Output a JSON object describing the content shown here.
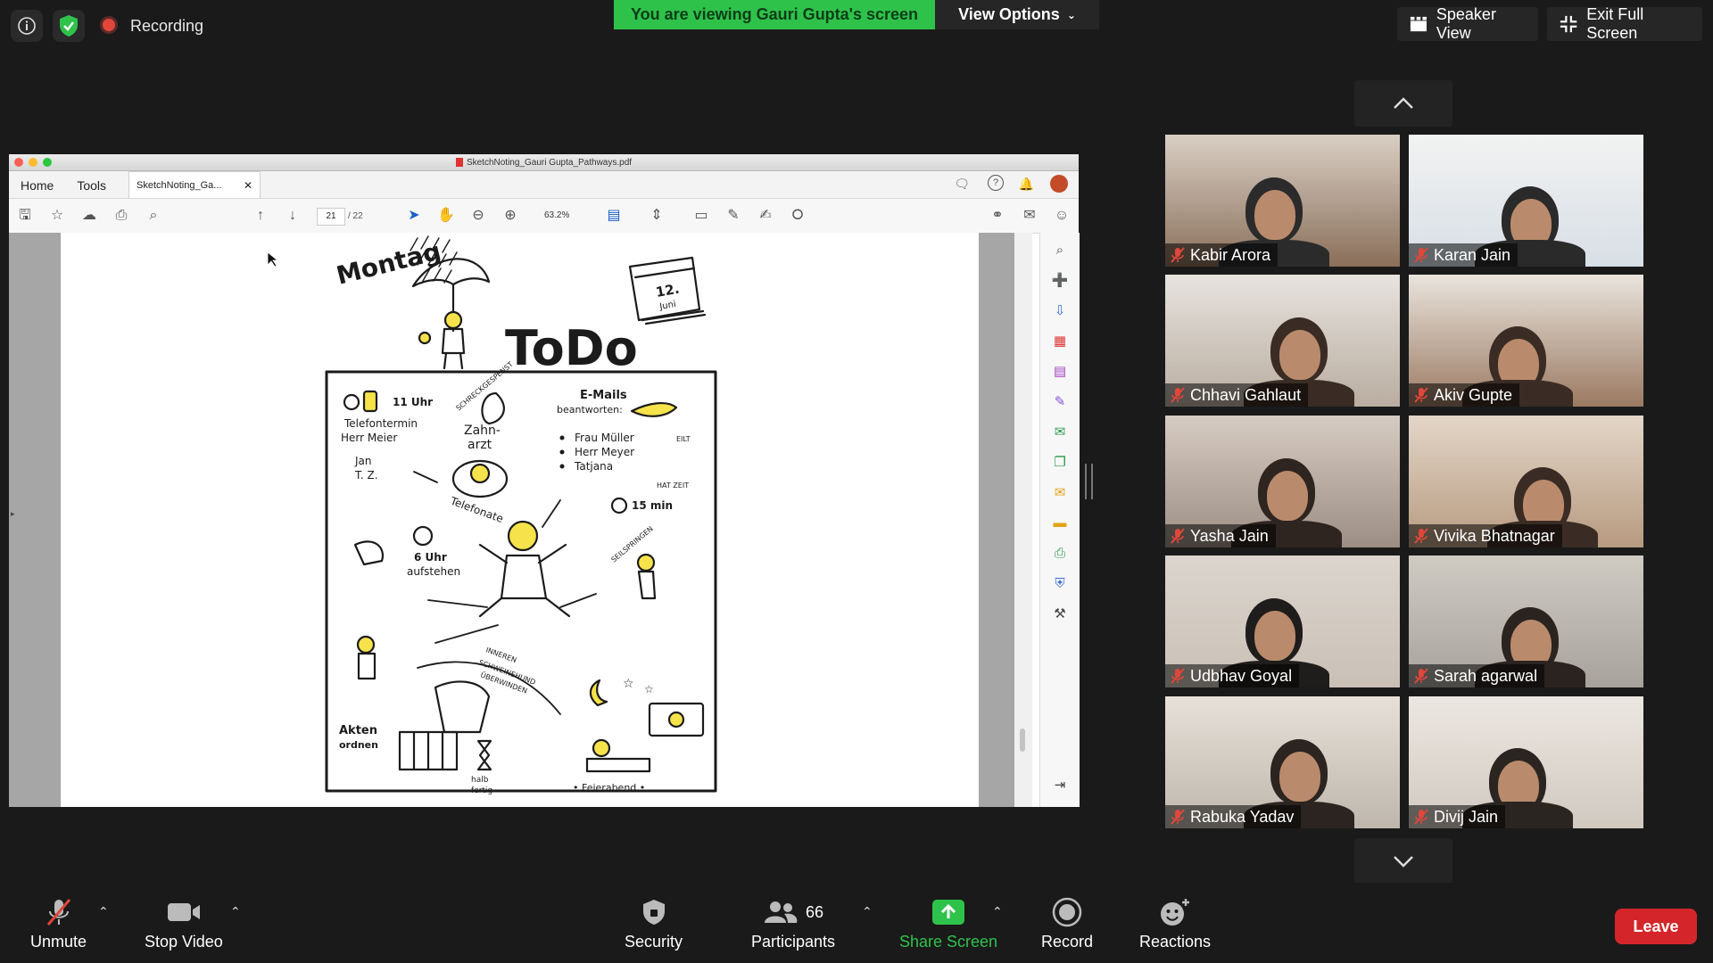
{
  "top_bar": {
    "recording_label": "Recording",
    "share_banner": "You are viewing Gauri Gupta's screen",
    "view_options_label": "View Options",
    "speaker_view_label": "Speaker View",
    "exit_fullscreen_label": "Exit Full Screen"
  },
  "pdf_viewer": {
    "window_title": "SketchNoting_Gauri Gupta_Pathways.pdf",
    "menu": [
      "Home",
      "Tools"
    ],
    "doc_tab_label": "SketchNoting_Ga...",
    "page_current": "21",
    "page_total": "/ 22",
    "zoom": "63.2%"
  },
  "sketch": {
    "day_title": "Montag",
    "calendar_day": "12.",
    "calendar_month": "Juni",
    "heading": "ToDo",
    "time_11": "11 Uhr",
    "phone_appt_1": "Telefontermin",
    "phone_appt_2": "Herr Meier",
    "dentist_1": "Zahn-",
    "dentist_2": "arzt",
    "email_title": "E-Mails",
    "email_sub": "beantworten:",
    "email_1": "Frau Müller",
    "email_2": "Herr Meyer",
    "email_3": "Tatjana",
    "eilt": "EILT",
    "hat_zeit": "HAT ZEIT",
    "call_1": "Jan",
    "call_2": "T. Z.",
    "telefonate": "Telefonate",
    "minutes_15": "15 min",
    "seilspringen": "SEILSPRINGEN",
    "wake_time": "6 Uhr",
    "wake_label": "aufstehen",
    "innerer_1": "INNEREN",
    "innerer_2": "SCHWEINEHUND",
    "innerer_3": "ÜBERWINDEN",
    "akten_1": "Akten",
    "akten_2": "ordnen",
    "halb_1": "halb",
    "halb_2": "fertig",
    "feierabend": "• Feierabend •",
    "schreck": "SCHRECKGESPENST"
  },
  "participants": [
    {
      "name": "Kabir Arora",
      "muted": true
    },
    {
      "name": "Karan Jain",
      "muted": true
    },
    {
      "name": "Chhavi Gahlaut",
      "muted": true
    },
    {
      "name": "Akiv Gupte",
      "muted": true
    },
    {
      "name": "Yasha Jain",
      "muted": true
    },
    {
      "name": "Vivika Bhatnagar",
      "muted": true
    },
    {
      "name": "Udbhav Goyal",
      "muted": true
    },
    {
      "name": "Sarah agarwal",
      "muted": true
    },
    {
      "name": "Rabuka Yadav",
      "muted": true
    },
    {
      "name": "Divij Jain",
      "muted": true
    }
  ],
  "bottom_bar": {
    "unmute": "Unmute",
    "stop_video": "Stop Video",
    "security": "Security",
    "participants": "Participants",
    "participant_count": "66",
    "share_screen": "Share Screen",
    "record": "Record",
    "reactions": "Reactions",
    "leave": "Leave"
  },
  "colors": {
    "share_green": "#2fc24b",
    "leave_red": "#d4262a",
    "mute_red": "#e0463a",
    "background": "#1a1a1a"
  }
}
